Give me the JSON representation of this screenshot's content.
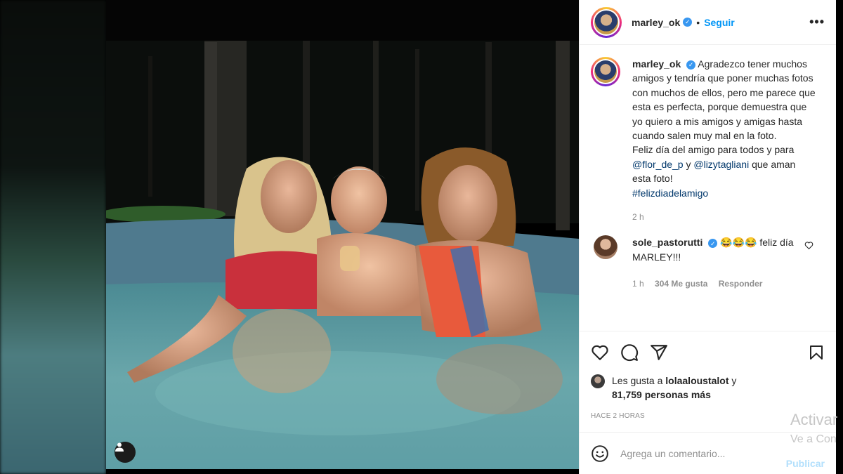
{
  "post": {
    "username": "marley_ok",
    "follow_label": "Seguir",
    "separator": "•",
    "more_icon": "more-horizontal-icon"
  },
  "caption": {
    "username": "marley_ok",
    "text_before": "Agradezco tener muchos amigos y tendría que poner muchas fotos con muchos de ellos, pero me parece que esta es perfecta, porque demuestra que yo quiero a mis amigos y amigas hasta cuando salen muy mal en la foto.",
    "line2": "Feliz día del amigo para todos y para",
    "mention1": "@flor_de_p",
    "connector": "y",
    "mention2": "@lizytagliani",
    "tail": "que aman esta foto!",
    "hashtag": "#felizdiadelamigo",
    "time": "2 h"
  },
  "comment": {
    "username": "sole_pastorutti",
    "emoji": "😂😂😂",
    "text": "feliz día MARLEY!!!",
    "time": "1 h",
    "likes": "304 Me gusta",
    "reply": "Responder"
  },
  "likes": {
    "prefix": "Les gusta a",
    "user": "lolaaloustalot",
    "connector": "y",
    "count_text": "81,759 personas más"
  },
  "timestamp": "HACE 2 HORAS",
  "add_comment": {
    "placeholder": "Agrega un comentario...",
    "publish": "Publicar"
  },
  "watermark": {
    "line1": "Activar",
    "line2": "Ve a Con"
  },
  "colors": {
    "accent": "#0095f6",
    "verified": "#3897f0",
    "mention": "#00376b",
    "publish_disabled": "#b2dffc"
  }
}
